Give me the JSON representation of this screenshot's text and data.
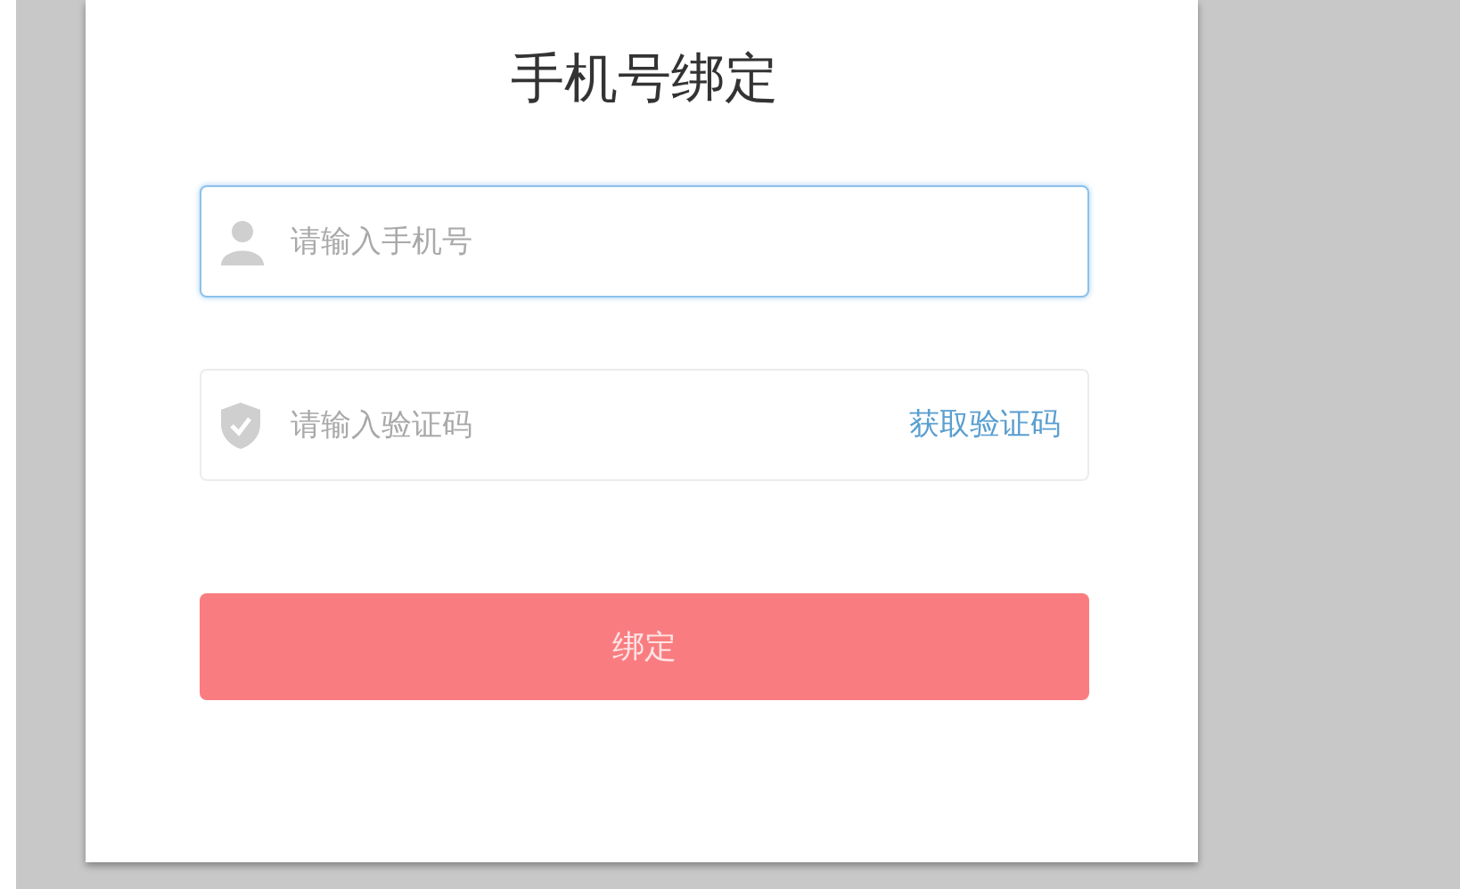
{
  "title": "手机号绑定",
  "fields": [
    {
      "kind": "phone",
      "placeholder": "请输入手机号",
      "focused": true
    },
    {
      "kind": "code",
      "placeholder": "请输入验证码",
      "focused": false,
      "action": "获取验证码"
    }
  ],
  "submit": {
    "label": "绑定",
    "disabled": true
  }
}
